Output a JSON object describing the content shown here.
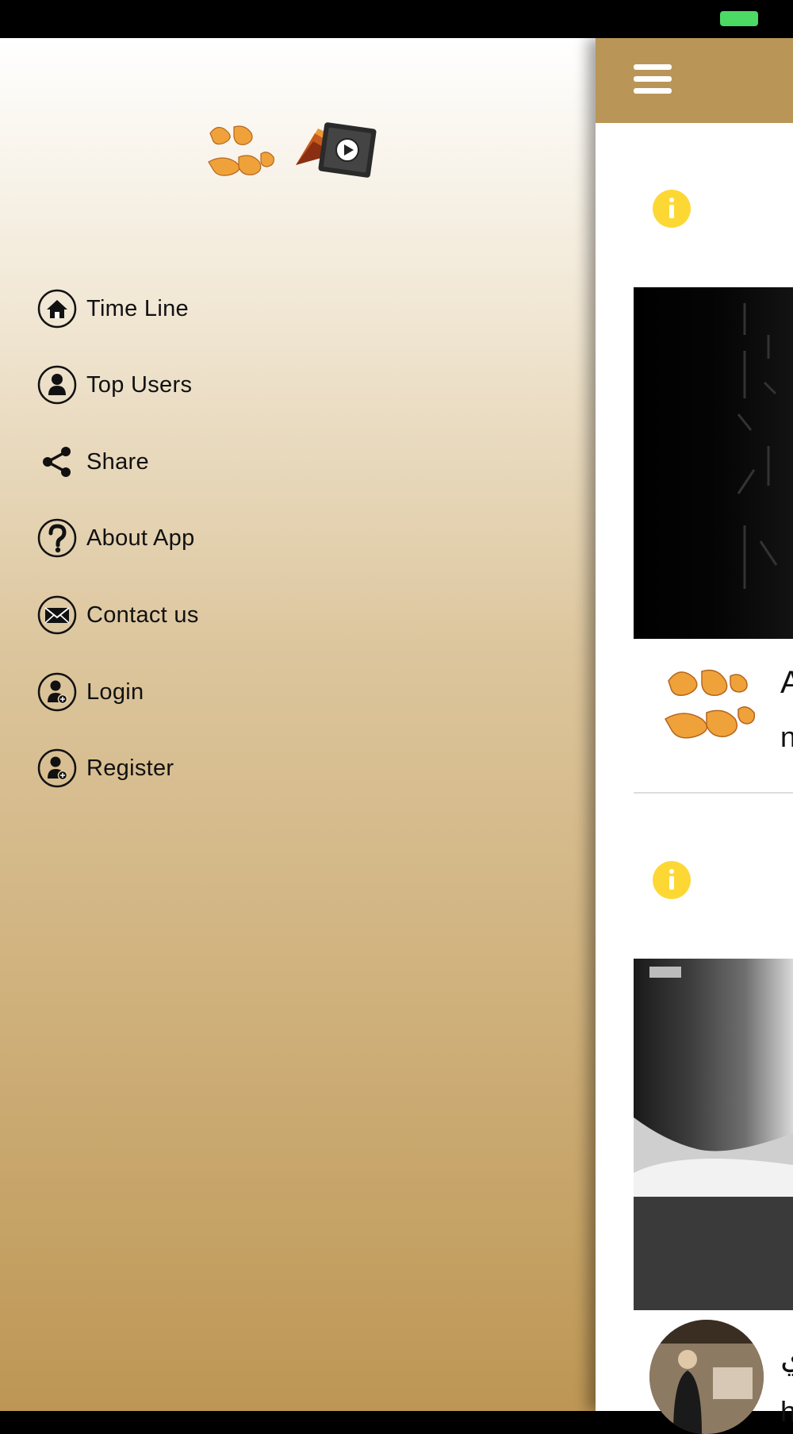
{
  "drawer": {
    "logo_alt": "قصة وقاص",
    "items": [
      {
        "label": "Time Line",
        "icon": "home-icon"
      },
      {
        "label": "Top Users",
        "icon": "user-icon"
      },
      {
        "label": "Share",
        "icon": "share-icon"
      },
      {
        "label": "About App",
        "icon": "question-icon"
      },
      {
        "label": "Contact us",
        "icon": "mail-icon"
      },
      {
        "label": "Login",
        "icon": "user-add-icon"
      },
      {
        "label": "Register",
        "icon": "user-add-icon"
      }
    ]
  },
  "main": {
    "posts": [
      {
        "title_fragment": "A",
        "sub_fragment": "n"
      },
      {
        "title_fragment": "ي",
        "sub_fragment": "h"
      }
    ]
  },
  "colors": {
    "accent": "#b99557",
    "info": "#fdd835",
    "battery": "#4cd964"
  }
}
